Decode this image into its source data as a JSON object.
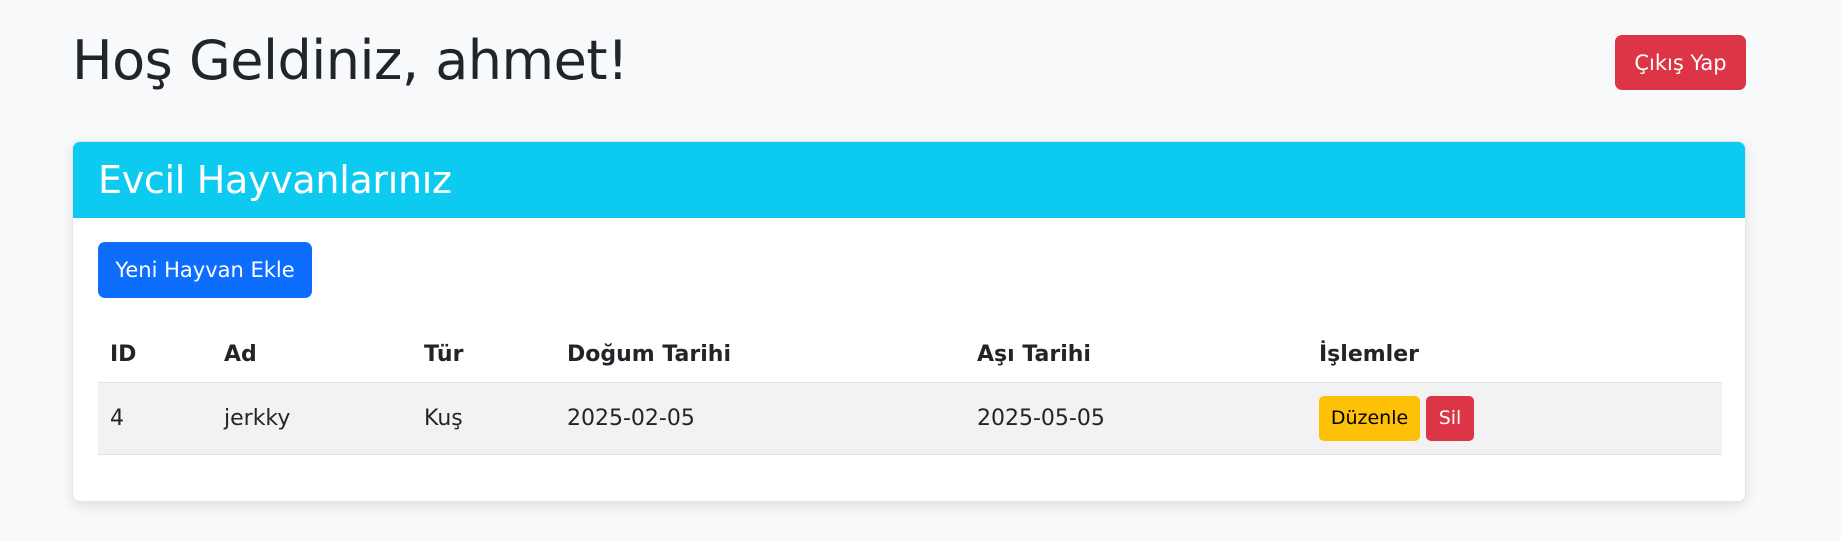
{
  "header": {
    "title": "Hoş Geldiniz, ahmet!",
    "logout_label": "Çıkış Yap"
  },
  "card": {
    "title": "Evcil Hayvanlarınız",
    "add_button_label": "Yeni Hayvan Ekle"
  },
  "table": {
    "columns": [
      "ID",
      "Ad",
      "Tür",
      "Doğum Tarihi",
      "Aşı Tarihi",
      "İşlemler"
    ],
    "rows": [
      {
        "id": "4",
        "name": "jerkky",
        "type": "Kuş",
        "birth_date": "2025-02-05",
        "vaccine_date": "2025-05-05",
        "edit_label": "Düzenle",
        "delete_label": "Sil"
      }
    ]
  },
  "colors": {
    "background": "#f8f9fa",
    "card_header": "#0dcaf0",
    "primary": "#0d6efd",
    "danger": "#dc3545",
    "warning": "#ffc107"
  }
}
